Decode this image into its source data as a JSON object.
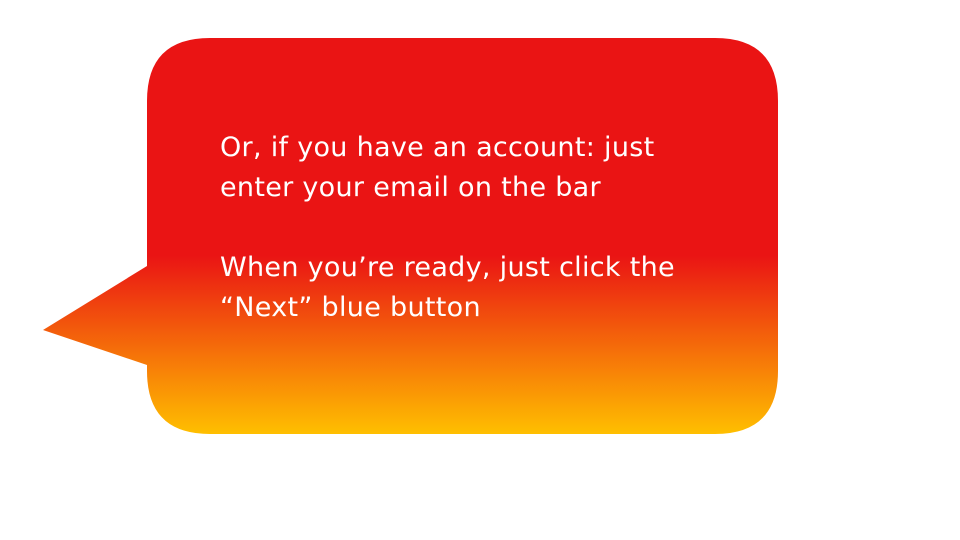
{
  "bubble": {
    "colors": {
      "top": "#ea1414",
      "bottom": "#ffbf00"
    },
    "paragraphs": [
      {
        "lines": [
          "Or, if you have an account: just",
          "enter your email on the bar"
        ]
      },
      {
        "lines": [
          "When you’re ready, just click the",
          "“Next” blue button"
        ]
      }
    ]
  }
}
